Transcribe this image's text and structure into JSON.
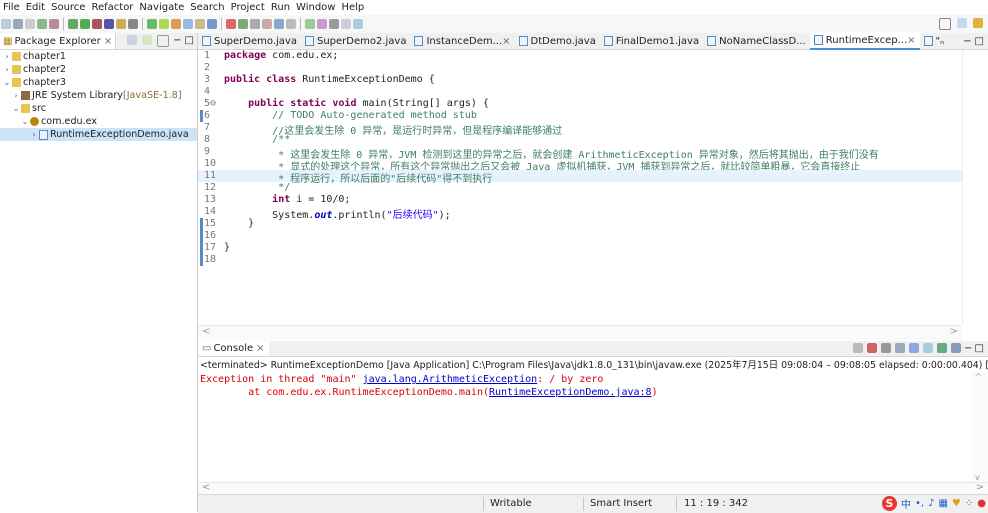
{
  "menu": [
    "File",
    "Edit",
    "Source",
    "Refactor",
    "Navigate",
    "Search",
    "Project",
    "Run",
    "Window",
    "Help"
  ],
  "package_explorer": {
    "title": "Package Explorer",
    "tree": [
      {
        "label": "chapter1",
        "type": "project",
        "depth": 0,
        "twisty": ">"
      },
      {
        "label": "chapter2",
        "type": "project",
        "depth": 0,
        "twisty": ">"
      },
      {
        "label": "chapter3",
        "type": "project",
        "depth": 0,
        "twisty": "v"
      },
      {
        "label": "JRE System Library",
        "suffix": "[JavaSE-1.8]",
        "type": "library",
        "depth": 1,
        "twisty": ">"
      },
      {
        "label": "src",
        "type": "folder",
        "depth": 1,
        "twisty": "v"
      },
      {
        "label": "com.edu.ex",
        "type": "package",
        "depth": 2,
        "twisty": "v"
      },
      {
        "label": "RuntimeExceptionDemo.java",
        "type": "java",
        "depth": 3,
        "twisty": ">",
        "selected": true
      }
    ]
  },
  "editor": {
    "tabs": [
      {
        "label": "SuperDemo.java"
      },
      {
        "label": "SuperDemo2.java"
      },
      {
        "label": "InstanceDem...",
        "close": "×"
      },
      {
        "label": "DtDemo.java"
      },
      {
        "label": "FinalDemo1.java"
      },
      {
        "label": "NoNameClassD..."
      },
      {
        "label": "RuntimeExcep...",
        "close": "×",
        "active": true
      },
      {
        "label": "\"ₙ"
      }
    ],
    "lines": [
      {
        "n": "1",
        "parts": [
          [
            "kw",
            "package"
          ],
          [
            "",
            " com.edu.ex;"
          ]
        ]
      },
      {
        "n": "2",
        "parts": []
      },
      {
        "n": "3",
        "parts": [
          [
            "kw",
            "public class"
          ],
          [
            "",
            " RuntimeExceptionDemo {"
          ]
        ]
      },
      {
        "n": "4",
        "parts": []
      },
      {
        "n": "5⊖",
        "parts": [
          [
            "",
            "    "
          ],
          [
            "kw",
            "public static void"
          ],
          [
            "",
            " main(String[] args) {"
          ]
        ]
      },
      {
        "n": "6",
        "parts": [
          [
            "cm",
            "        // TODO Auto-generated method stub"
          ]
        ]
      },
      {
        "n": "7",
        "parts": [
          [
            "cm",
            "        //这里会发生除 0 异常，是运行时异常，但是程序编译能够通过"
          ]
        ]
      },
      {
        "n": "8",
        "parts": [
          [
            "cm",
            "        /**"
          ]
        ]
      },
      {
        "n": "9",
        "parts": [
          [
            "cm",
            "         * 这里会发生除 0 异常，JVM 检测到这里的异常之后，就会创建 ArithmeticException 异常对象，然后将其抛出，由于我们没有"
          ]
        ]
      },
      {
        "n": "10",
        "parts": [
          [
            "cm",
            "         * 显式的处理这个异常，所有这个异常抛出之后又会被 Java 虚拟机捕获，JVM 捕获到异常之后，就比较简单粗暴，它会直接终止"
          ]
        ]
      },
      {
        "n": "11",
        "parts": [
          [
            "cm",
            "         * 程序运行，所以后面的\"后续代码\"得不到执行"
          ]
        ],
        "current": true
      },
      {
        "n": "12",
        "parts": [
          [
            "cm",
            "         */"
          ]
        ]
      },
      {
        "n": "13",
        "parts": [
          [
            "",
            "        "
          ],
          [
            "kw",
            "int"
          ],
          [
            "",
            " i = 10/0;"
          ]
        ]
      },
      {
        "n": "14",
        "parts": [
          [
            "",
            "        System."
          ],
          [
            "sf",
            "out"
          ],
          [
            "",
            ".println("
          ],
          [
            "str",
            "\"后续代码\""
          ],
          [
            "",
            ");"
          ]
        ]
      },
      {
        "n": "15",
        "parts": [
          [
            "",
            "    }"
          ]
        ]
      },
      {
        "n": "16",
        "parts": []
      },
      {
        "n": "17",
        "parts": [
          [
            "",
            "}"
          ]
        ]
      },
      {
        "n": "18",
        "parts": []
      }
    ]
  },
  "console": {
    "tab_label": "Console",
    "description": "<terminated> RuntimeExceptionDemo [Java Application] C:\\Program Files\\Java\\jdk1.8.0_131\\bin\\javaw.exe  (2025年7月15日 09:08:04 – 09:08:05 elapsed: 0:00:00.404) [pid: 2039",
    "line1_prefix": "Exception in thread \"main\" ",
    "line1_link": "java.lang.ArithmeticException",
    "line1_suffix": ": / by zero",
    "line2_prefix": "\tat com.edu.ex.RuntimeExceptionDemo.main(",
    "line2_link": "RuntimeExceptionDemo.java:8",
    "line2_suffix": ")"
  },
  "status_bar": {
    "writable": "Writable",
    "insert_mode": "Smart Insert",
    "position": "11 : 19 : 342"
  },
  "ime": {
    "logo": "S",
    "lang": "中"
  },
  "colors": {
    "keyword": "#7f0055",
    "comment": "#3f7f5f",
    "string": "#2a00ff",
    "error": "#dd0000",
    "link": "#0000cc",
    "selection": "#cce4f7"
  }
}
